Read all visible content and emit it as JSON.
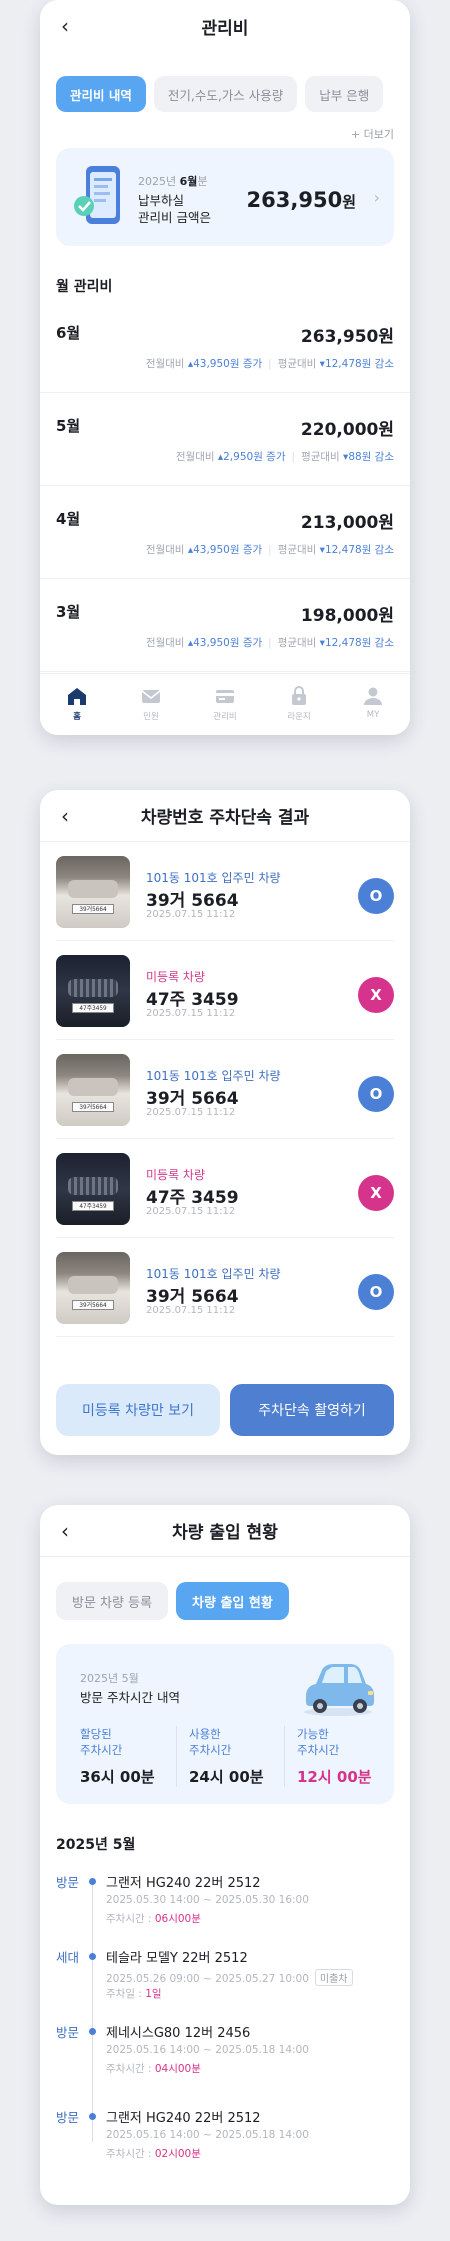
{
  "fee": {
    "title": "관리비",
    "tabs": [
      "관리비 내역",
      "전기,수도,가스 사용량",
      "납부 은행"
    ],
    "more": "+ 더보기",
    "banner": {
      "year": "2025년",
      "month": "6월",
      "period_suffix": "분",
      "line1": "납부하실",
      "line2": "관리비 금액은",
      "amount": "263,950",
      "unit": "원"
    },
    "section_title": "월 관리비",
    "rows": [
      {
        "month": "6월",
        "amount": "263,950원",
        "prev_label": "전월대비",
        "prev_val": "▴43,950원 증가",
        "avg_label": "평균대비",
        "avg_val": "▾12,478원 감소"
      },
      {
        "month": "5월",
        "amount": "220,000원",
        "prev_label": "전월대비",
        "prev_val": "▴2,950원 증가",
        "avg_label": "평균대비",
        "avg_val": "▾88원 감소"
      },
      {
        "month": "4월",
        "amount": "213,000원",
        "prev_label": "전월대비",
        "prev_val": "▴43,950원 증가",
        "avg_label": "평균대비",
        "avg_val": "▾12,478원 감소"
      },
      {
        "month": "3월",
        "amount": "198,000원",
        "prev_label": "전월대비",
        "prev_val": "▴43,950원 증가",
        "avg_label": "평균대비",
        "avg_val": "▾12,478원 감소"
      }
    ],
    "nav": [
      {
        "label": "홈",
        "icon": "home-icon"
      },
      {
        "label": "민원",
        "icon": "mail-icon"
      },
      {
        "label": "관리비",
        "icon": "card-icon"
      },
      {
        "label": "라운지",
        "icon": "lock-icon"
      },
      {
        "label": "MY",
        "icon": "person-icon"
      }
    ],
    "accent": "#58a5f2"
  },
  "parking": {
    "title": "차량번호 주차단속 결과",
    "vehicles": [
      {
        "type": "101동 101호 입주민 차량",
        "number": "39거 5664",
        "date": "2025.07.15 11:12",
        "result": "O",
        "plate": "39거5664"
      },
      {
        "type": "미등록 차량",
        "number": "47주 3459",
        "date": "2025.07.15 11:12",
        "result": "X",
        "plate": "47주3459"
      },
      {
        "type": "101동 101호 입주민 차량",
        "number": "39거 5664",
        "date": "2025.07.15 11:12",
        "result": "O",
        "plate": "39거5664"
      },
      {
        "type": "미등록 차량",
        "number": "47주 3459",
        "date": "2025.07.15 11:12",
        "result": "X",
        "plate": "47주3459"
      },
      {
        "type": "101동 101호 입주민 차량",
        "number": "39거 5664",
        "date": "2025.07.15 11:12",
        "result": "O",
        "plate": "39거5664"
      }
    ],
    "btn_unregistered": "미등록 차량만 보기",
    "btn_capture": "주차단속 촬영하기"
  },
  "access": {
    "title": "차량 출입 현황",
    "tabs": [
      "방문 차량 등록",
      "차량 출입 현황"
    ],
    "summary": {
      "period": "2025년 5월",
      "heading": "방문 주차시간 내역",
      "cols": [
        {
          "label1": "할당된",
          "label2": "주차시간",
          "value": "36시 00분"
        },
        {
          "label1": "사용한",
          "label2": "주차시간",
          "value": "24시 00분"
        },
        {
          "label1": "가능한",
          "label2": "주차시간",
          "value": "12시 00분"
        }
      ]
    },
    "month": "2025년 5월",
    "entries": [
      {
        "kind": "방문",
        "name": "그랜저 HG240  22버 2512",
        "dates": "2025.05.30 14:00 ~ 2025.05.30 16:00",
        "plabel": "주차시간 : ",
        "pval": "06시00분",
        "tag": ""
      },
      {
        "kind": "세대",
        "name": "테슬라 모델Y  22버 2512",
        "dates": "2025.05.26 09:00 ~ 2025.05.27 10:00",
        "plabel": "주차일 : ",
        "pval": "1일",
        "tag": "미출차"
      },
      {
        "kind": "방문",
        "name": "제네시스G80 12버 2456",
        "dates": "2025.05.16 14:00 ~ 2025.05.18 14:00",
        "plabel": "주차시간 : ",
        "pval": "04시00분",
        "tag": ""
      },
      {
        "kind": "방문",
        "name": "그랜저 HG240  22버 2512",
        "dates": "2025.05.16 14:00 ~ 2025.05.18 14:00",
        "plabel": "주차시간 : ",
        "pval": "02시00분",
        "tag": ""
      }
    ]
  }
}
